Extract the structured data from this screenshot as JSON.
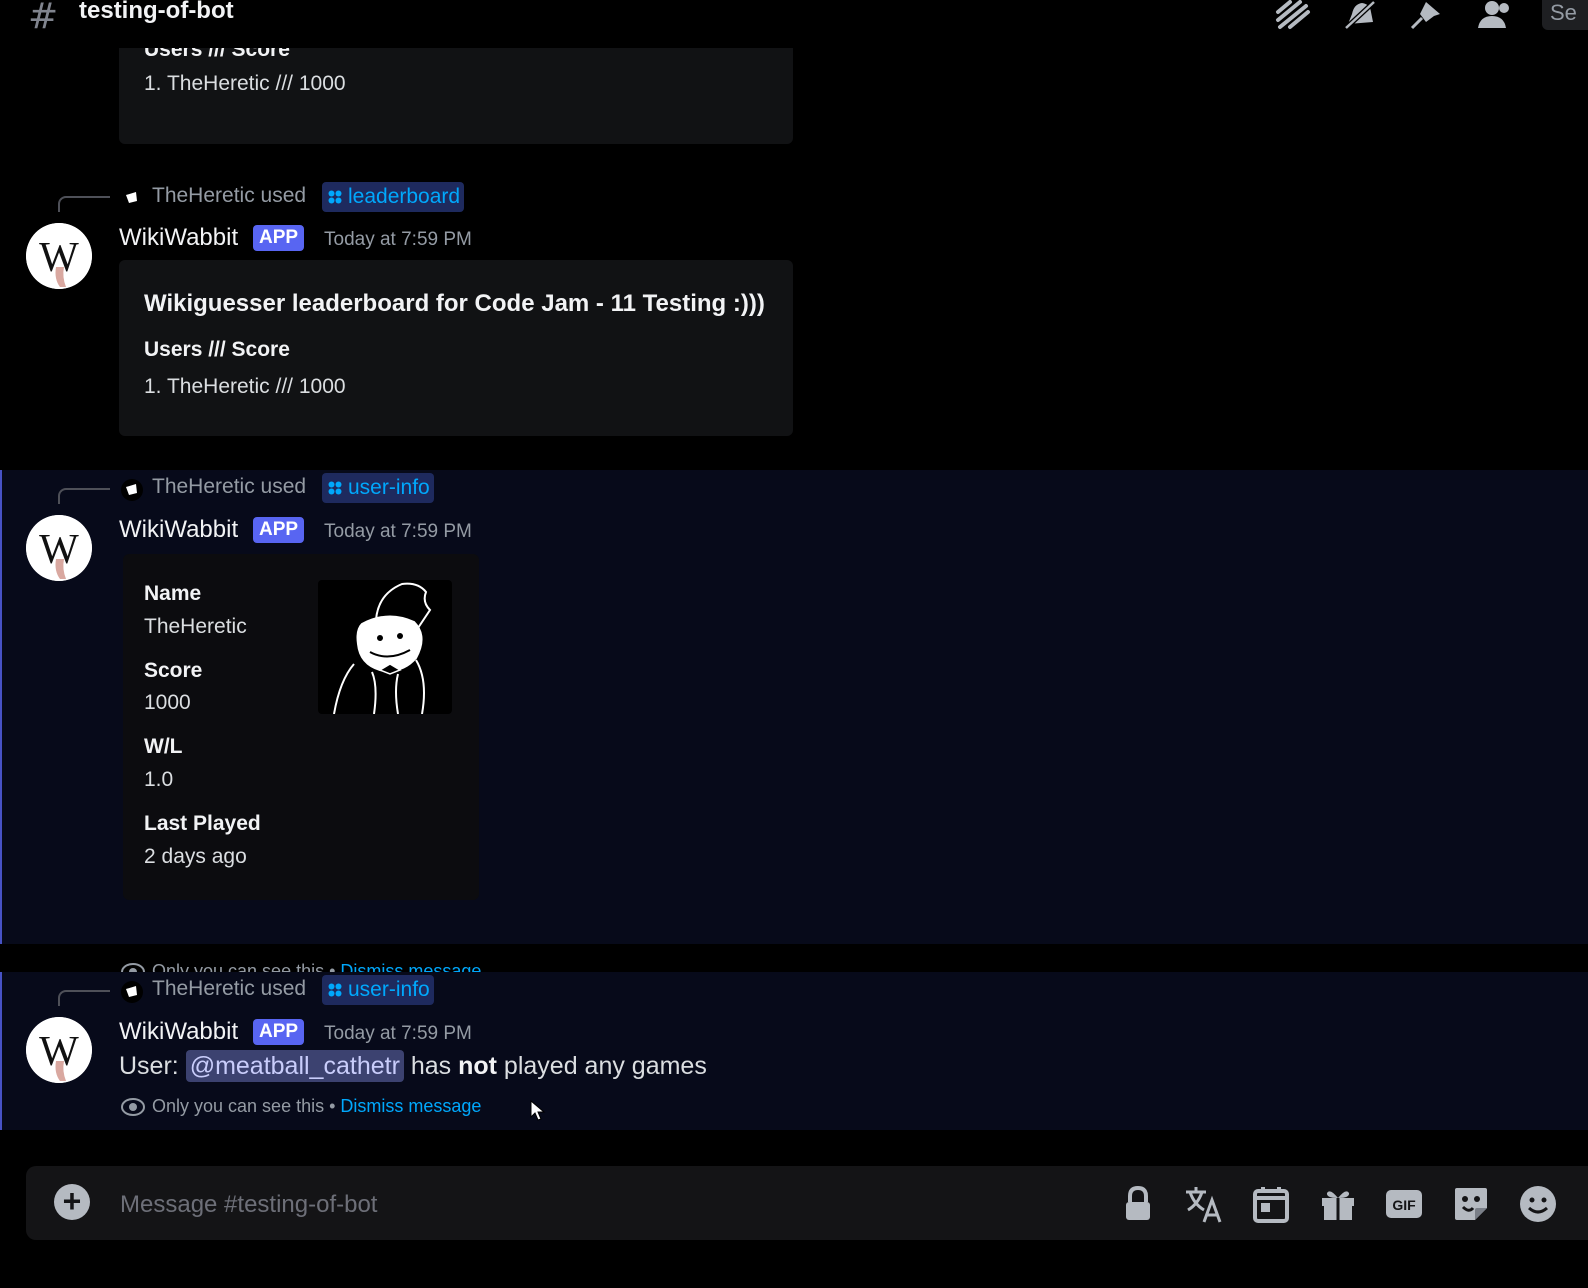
{
  "header": {
    "channel_name": "testing-of-bot",
    "search_stub": "Se"
  },
  "messages": [
    {
      "embed": {
        "field_name": "Users /// Score",
        "field_value": "1. TheHeretic /// 1000"
      }
    },
    {
      "reply": {
        "user": "TheHeretic",
        "used_text": "used",
        "command": "leaderboard"
      },
      "author": "WikiWabbit",
      "badge": "APP",
      "timestamp": "Today at 7:59 PM",
      "embed": {
        "title": "Wikiguesser leaderboard for Code Jam - 11 Testing :)))",
        "field_name": "Users /// Score",
        "field_value": "1. TheHeretic /// 1000"
      }
    },
    {
      "reply": {
        "user": "TheHeretic",
        "used_text": "used",
        "command": "user-info"
      },
      "author": "WikiWabbit",
      "badge": "APP",
      "timestamp": "Today at 7:59 PM",
      "embed": {
        "fields": [
          {
            "name": "Name",
            "value": "TheHeretic"
          },
          {
            "name": "Score",
            "value": "1000"
          },
          {
            "name": "W/L",
            "value": "1.0"
          },
          {
            "name": "Last Played",
            "value": "2 days ago"
          }
        ]
      },
      "ephemeral_note": "Only you can see this • ",
      "dismiss_label": "Dismiss message"
    },
    {
      "reply": {
        "user": "TheHeretic",
        "used_text": "used",
        "command": "user-info"
      },
      "author": "WikiWabbit",
      "badge": "APP",
      "timestamp": "Today at 7:59 PM",
      "content": {
        "prefix": "User: ",
        "mention": "@meatball_cathetr",
        "middle": " has ",
        "bold": "not",
        "suffix": " played any games"
      },
      "ephemeral_note": "Only you can see this • ",
      "dismiss_label": "Dismiss message"
    }
  ],
  "composer": {
    "placeholder": "Message #testing-of-bot"
  },
  "icons": {
    "header": [
      "threads-icon",
      "mute-bell-icon",
      "pin-icon",
      "members-icon"
    ],
    "composer": [
      "lock-icon",
      "translate-icon",
      "calendar-icon",
      "gift-icon",
      "gif-icon",
      "sticker-icon",
      "emoji-icon"
    ],
    "gif_label": "GIF"
  },
  "colors": {
    "accent": "#5865f2",
    "link": "#00a8fc",
    "background": "#000000",
    "ephemeral_bg": "#070a1a"
  }
}
